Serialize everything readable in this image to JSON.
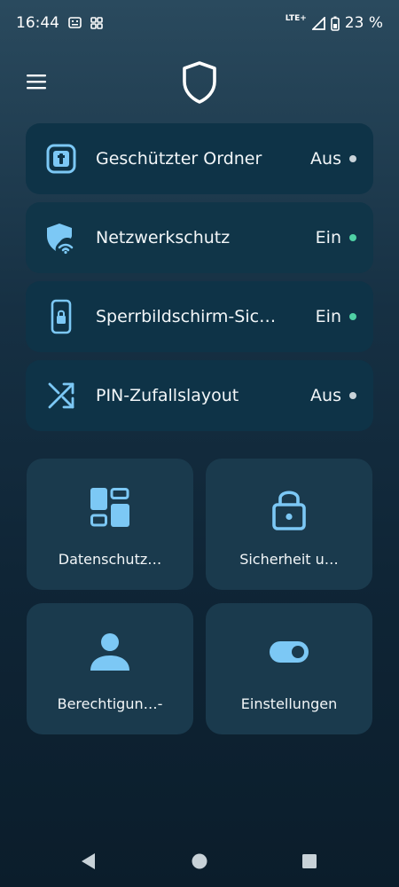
{
  "status_bar": {
    "time": "16:44",
    "network": "LTE+",
    "battery": "23 %",
    "icons": [
      "notification-app-icon",
      "grid-app-icon",
      "signal-icon",
      "battery-icon"
    ]
  },
  "header": {
    "menu_icon": "hamburger-menu-icon",
    "logo_icon": "shield-icon"
  },
  "toggles": [
    {
      "label": "Geschützter Ordner",
      "state": "Aus",
      "icon": "folder-lock-icon",
      "dot_color": "#c9d3d9"
    },
    {
      "label": "Netzwerkschutz",
      "state": "Ein",
      "icon": "shield-wifi-icon",
      "dot_color": "#4fd1a5"
    },
    {
      "label": "Sperrbildschirm-Sic…",
      "state": "Ein",
      "icon": "phone-lock-icon",
      "dot_color": "#4fd1a5"
    },
    {
      "label": "PIN-Zufallslayout",
      "state": "Aus",
      "icon": "shuffle-icon",
      "dot_color": "#c9d3d9"
    }
  ],
  "tiles": [
    {
      "label": "Datenschutz…",
      "icon": "dashboard-icon"
    },
    {
      "label": "Sicherheit u…",
      "icon": "lock-icon"
    },
    {
      "label": "Berechtigun…-",
      "icon": "person-icon"
    },
    {
      "label": "Einstellungen",
      "icon": "toggle-switch-icon"
    }
  ],
  "nav_bar": {
    "icons": [
      "back-icon",
      "home-icon",
      "recents-icon"
    ]
  },
  "colors": {
    "accent": "#7cc8f5",
    "on_dot": "#4fd1a5",
    "off_dot": "#c9d3d9",
    "card": "#0e3347",
    "tile": "#1a3a4d"
  }
}
